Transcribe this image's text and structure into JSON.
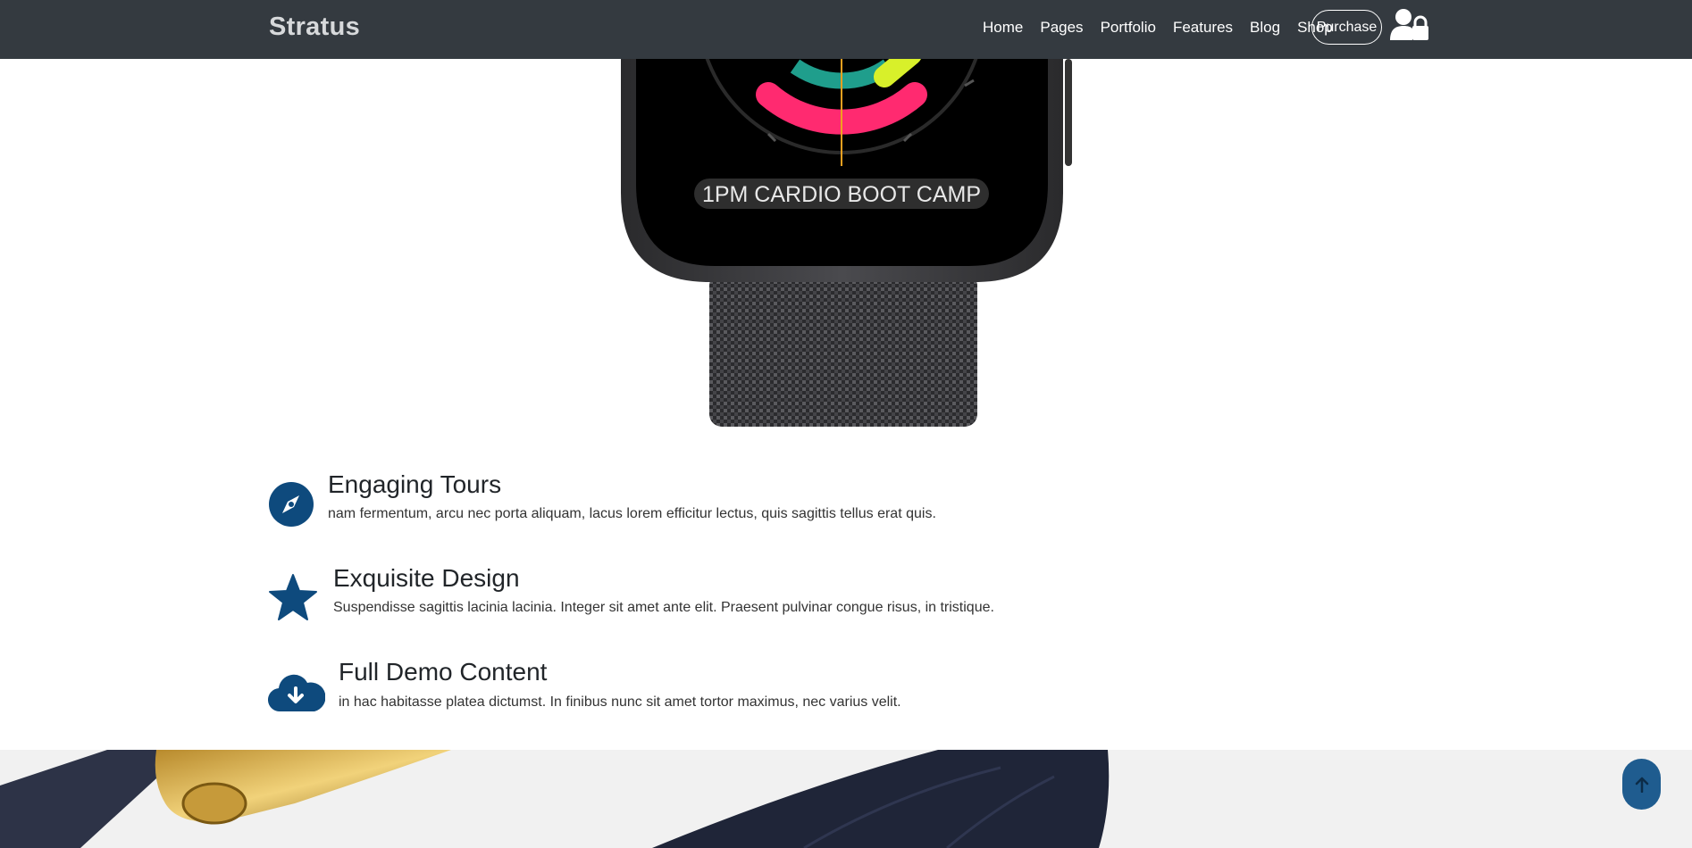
{
  "nav": {
    "brand": "Stratus",
    "links": [
      "Home",
      "Pages",
      "Portfolio",
      "Features",
      "Blog",
      "Shop"
    ],
    "purchase_label": "Purchase",
    "user_icon": "user-lock-icon"
  },
  "hero": {
    "watch_label": "1PM CARDIO BOOT CAMP"
  },
  "features": [
    {
      "icon": "compass-icon",
      "title": "Engaging Tours",
      "text": "nam fermentum, arcu nec porta aliquam, lacus lorem efficitur lectus, quis sagittis tellus erat quis."
    },
    {
      "icon": "star-icon",
      "title": "Exquisite Design",
      "text": "Suspendisse sagittis lacinia lacinia. Integer sit amet ante elit. Praesent pulvinar congue risus, in tristique."
    },
    {
      "icon": "cloud-download-icon",
      "title": "Full Demo Content",
      "text": "in hac habitasse platea dictumst. In finibus nunc sit amet tortor maximus, nec varius velit."
    }
  ],
  "scroll_top": {
    "icon": "arrow-up-icon"
  },
  "colors": {
    "navbar": "#343a40",
    "accent": "#0e4a7d",
    "scroll_button": "#1f5c8f",
    "band": "#f1f1f1"
  }
}
